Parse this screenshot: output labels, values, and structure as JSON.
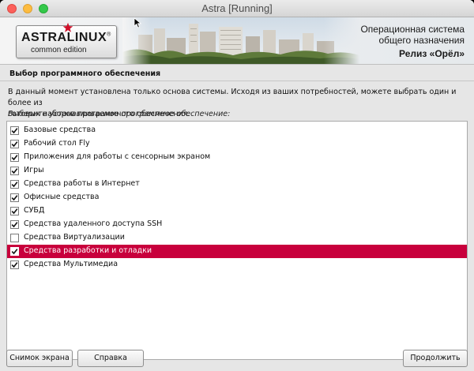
{
  "window": {
    "title": "Astra [Running]"
  },
  "banner": {
    "logo_main": "ASTRALINUX",
    "logo_registered": "®",
    "logo_sub": "common edition",
    "line1": "Операционная система",
    "line2": "общего назначения",
    "line3": "Релиз «Орёл»"
  },
  "section": {
    "title": "Выбор программного обеспечения",
    "description_line1": "В данный момент установлена только основа системы. Исходя из ваших потребностей, можете выбрать один и более из",
    "description_line2": "готовых наборов программного обеспечения.",
    "prompt": "Выберите устанавливаемое программное обеспечение:"
  },
  "software": [
    {
      "label": "Базовые средства",
      "checked": true,
      "selected": false
    },
    {
      "label": "Рабочий стол Fly",
      "checked": true,
      "selected": false
    },
    {
      "label": "Приложения для работы с сенсорным экраном",
      "checked": true,
      "selected": false
    },
    {
      "label": "Игры",
      "checked": true,
      "selected": false
    },
    {
      "label": "Средства работы в Интернет",
      "checked": true,
      "selected": false
    },
    {
      "label": "Офисные средства",
      "checked": true,
      "selected": false
    },
    {
      "label": "СУБД",
      "checked": true,
      "selected": false
    },
    {
      "label": "Средства удаленного доступа SSH",
      "checked": true,
      "selected": false
    },
    {
      "label": "Средства Виртуализации",
      "checked": false,
      "selected": false
    },
    {
      "label": "Средства разработки и отладки",
      "checked": true,
      "selected": true
    },
    {
      "label": "Средства Мультимедиа",
      "checked": true,
      "selected": false
    }
  ],
  "buttons": {
    "screenshot": "Снимок экрана",
    "help": "Справка",
    "continue": "Продолжить"
  },
  "colors": {
    "selection": "#c8003c",
    "logo_star": "#d0102a"
  }
}
